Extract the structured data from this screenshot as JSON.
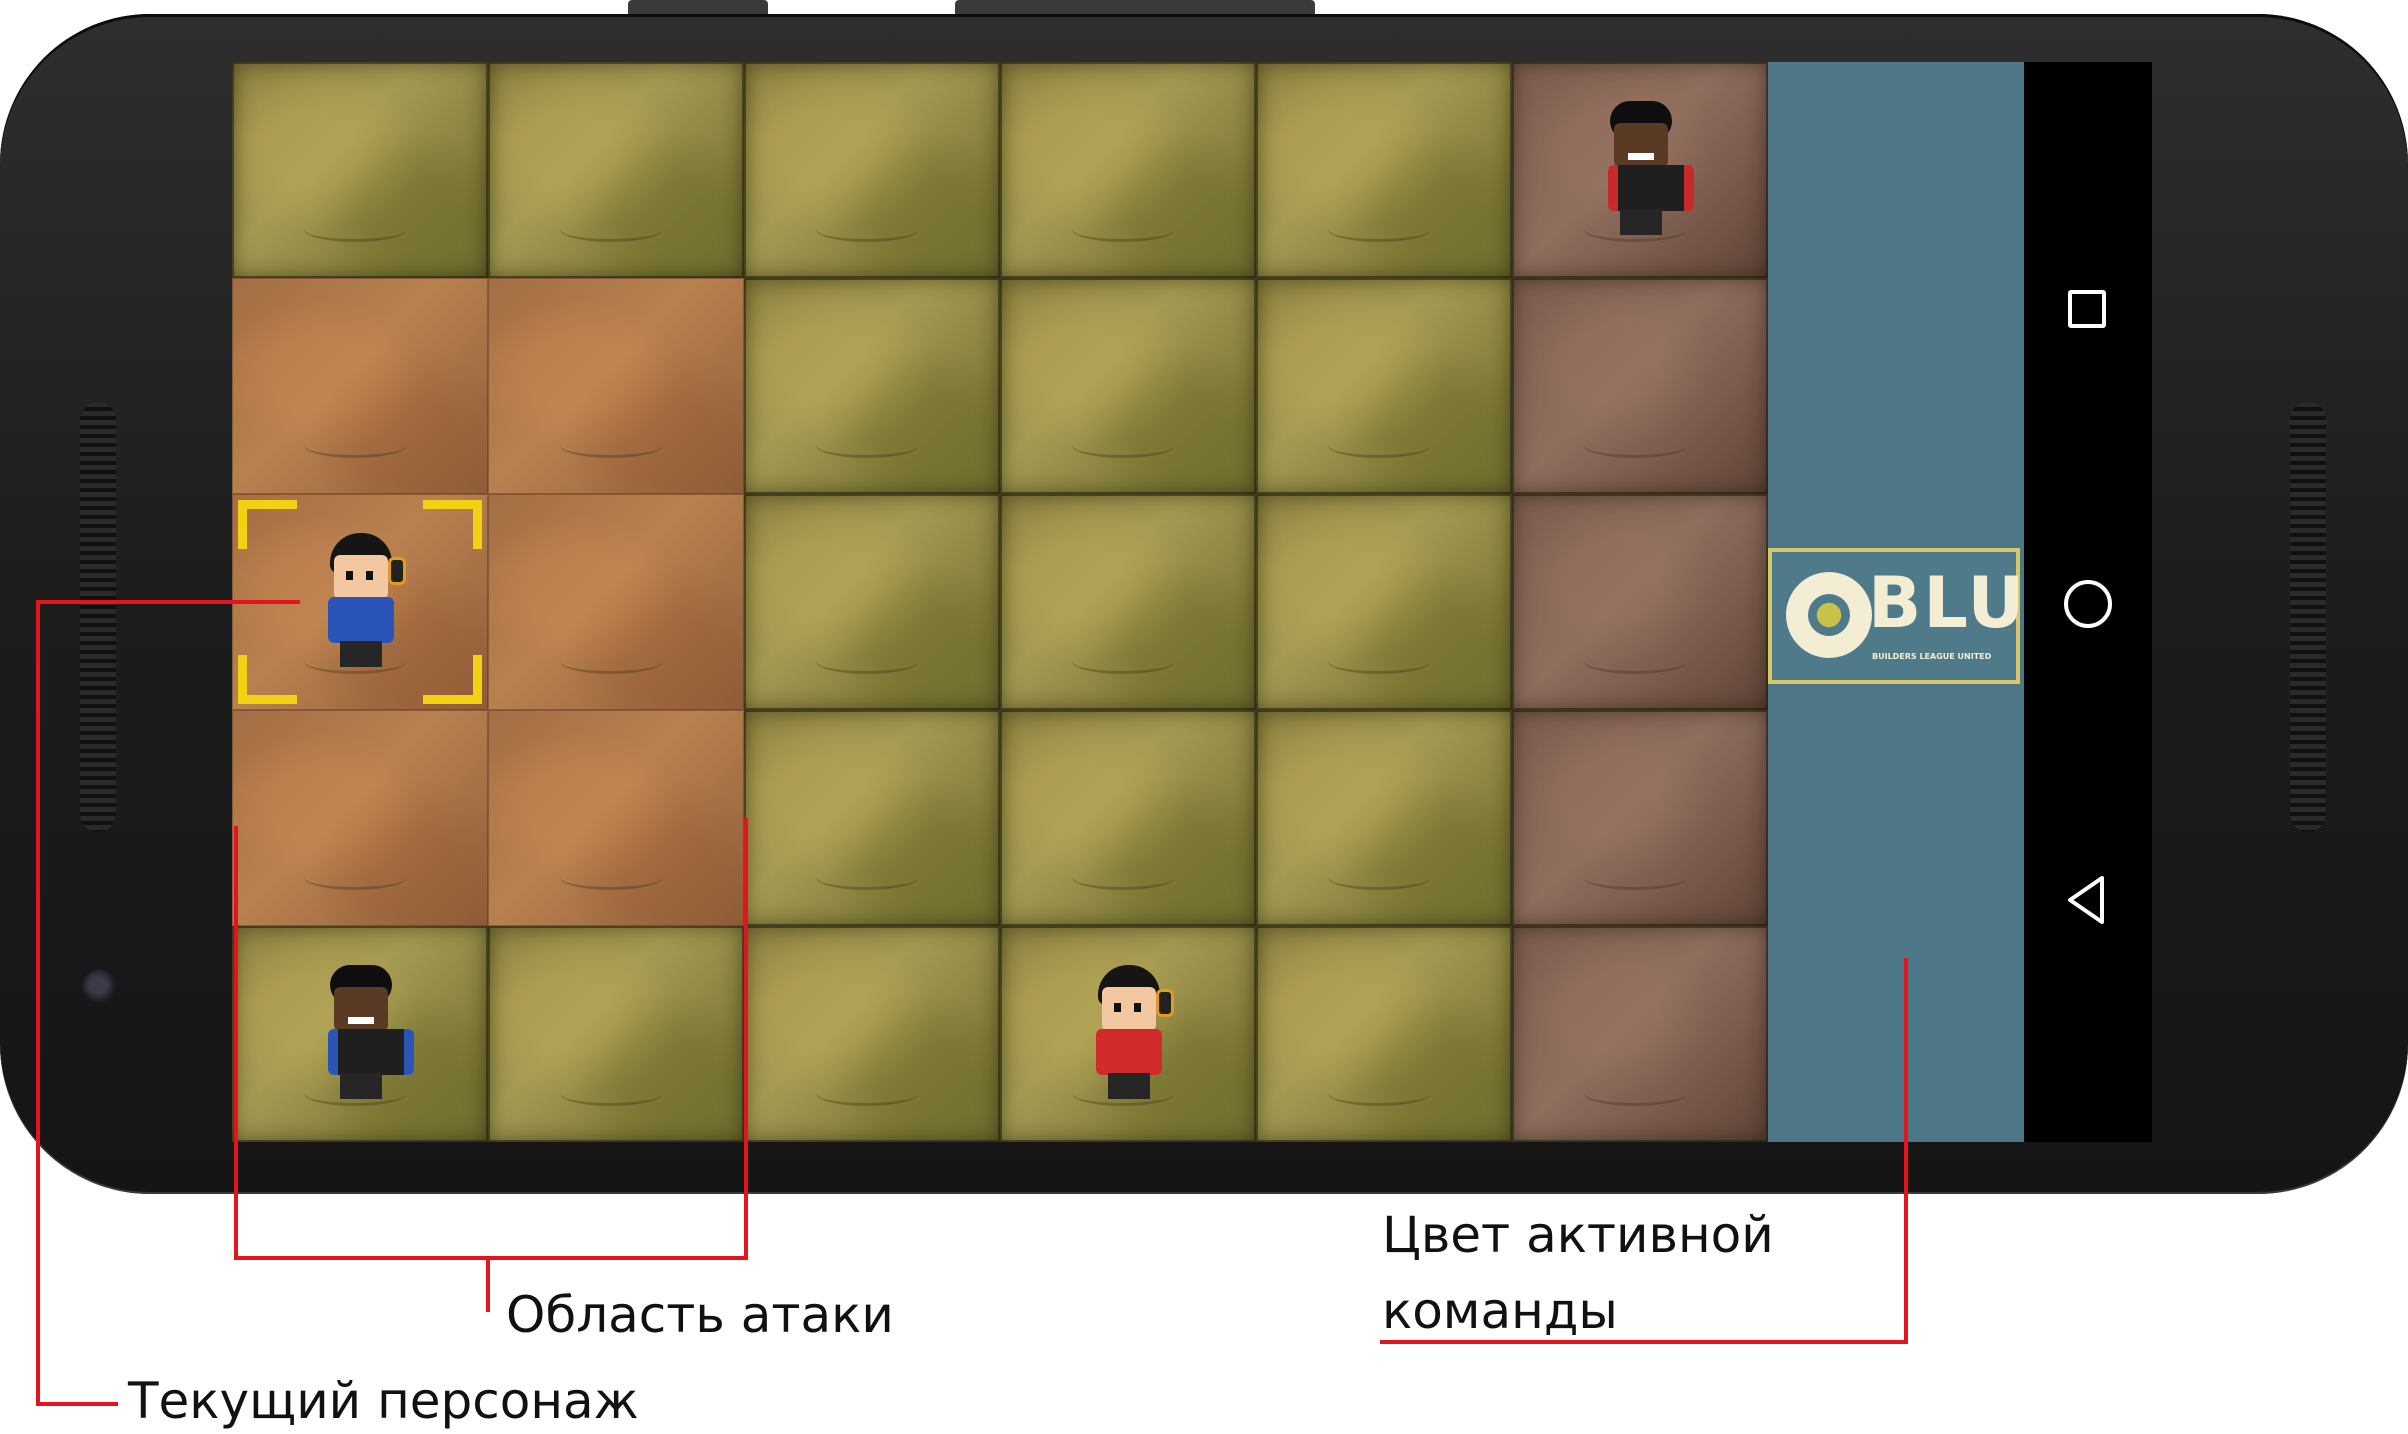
{
  "board": {
    "rows": [
      [
        "grass",
        "grass",
        "grass",
        "grass",
        "grass",
        "dirt"
      ],
      [
        "attack",
        "attack",
        "grass",
        "grass",
        "grass",
        "dirt"
      ],
      [
        "attack",
        "attack",
        "grass",
        "grass",
        "grass",
        "dirt"
      ],
      [
        "attack",
        "attack",
        "grass",
        "grass",
        "grass",
        "dirt"
      ],
      [
        "grass",
        "grass",
        "grass",
        "grass",
        "grass",
        "dirt"
      ]
    ]
  },
  "team_panel": {
    "color": "#4d7786",
    "logo_text": "BLU",
    "logo_subtitle": "BUILDERS LEAGUE UNITED"
  },
  "navbar": {
    "icons": [
      "recent-apps-icon",
      "home-icon",
      "back-icon"
    ]
  },
  "annotations": {
    "attack_area": "Область атаки",
    "current_character": "Текущий персонаж",
    "active_team_color_line1": "Цвет активной",
    "active_team_color_line2": "команды"
  },
  "colors": {
    "annotation_line": "#e3141e",
    "selector": "#f2d113",
    "red_team": "#d12a2a",
    "blue_team": "#2b54b8"
  }
}
